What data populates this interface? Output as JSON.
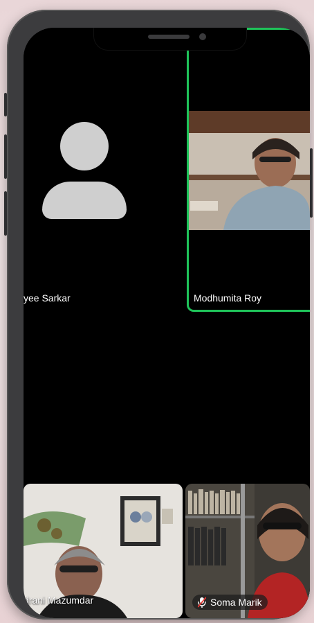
{
  "participants": [
    {
      "name": "yee Sarkar"
    },
    {
      "name": "Modhumita Roy"
    },
    {
      "name": "drani Mazumdar"
    },
    {
      "name": "Soma Marik"
    }
  ],
  "colors": {
    "active_speaker": "#1fc45a",
    "avatar": "#cfcfcf"
  },
  "icons": {
    "muted": "mic-muted-icon",
    "avatar": "person-avatar-icon"
  }
}
